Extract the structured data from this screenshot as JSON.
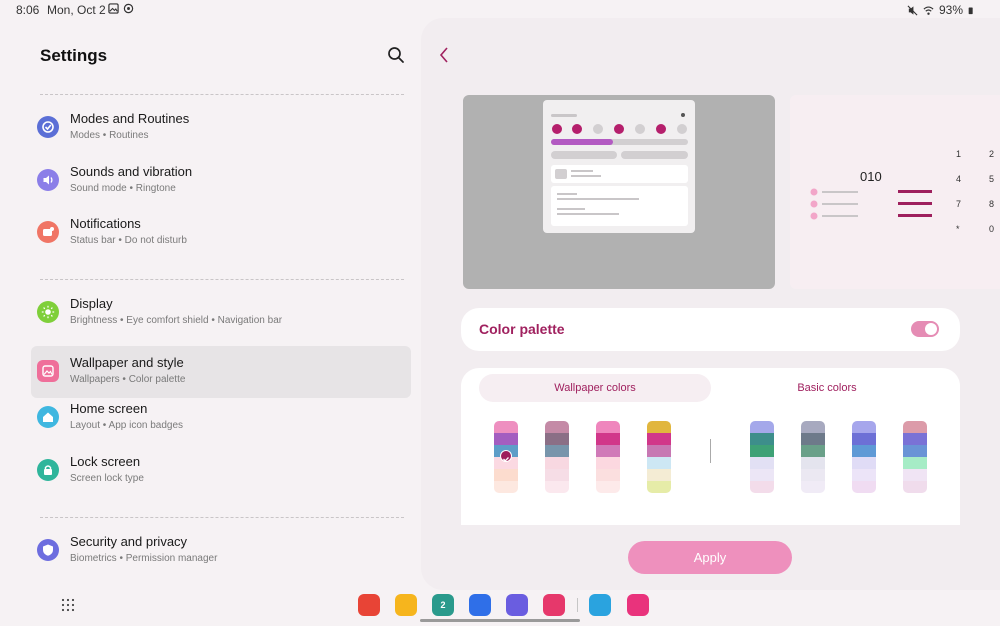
{
  "status_bar": {
    "time": "8:06",
    "date": "Mon, Oct 2",
    "battery": "93%"
  },
  "settings": {
    "title": "Settings",
    "items": [
      {
        "title": "Modes and Routines",
        "subtitle": "Modes  •  Routines",
        "color": "#5b6fd6"
      },
      {
        "title": "Sounds and vibration",
        "subtitle": "Sound mode  •  Ringtone",
        "color": "#8b7ee8"
      },
      {
        "title": "Notifications",
        "subtitle": "Status bar  •  Do not disturb",
        "color": "#f07565"
      },
      {
        "title": "Display",
        "subtitle": "Brightness  •  Eye comfort shield  •  Navigation bar",
        "color": "#7fcf3a"
      },
      {
        "title": "Wallpaper and style",
        "subtitle": "Wallpapers  •  Color palette",
        "color": "#ef6f9a"
      },
      {
        "title": "Home screen",
        "subtitle": "Layout  •  App icon badges",
        "color": "#3fb7e0"
      },
      {
        "title": "Lock screen",
        "subtitle": "Screen lock type",
        "color": "#2fb59b"
      },
      {
        "title": "Security and privacy",
        "subtitle": "Biometrics  •  Permission manager",
        "color": "#6d6ddf"
      }
    ]
  },
  "preview": {
    "number": "010",
    "dialpad": [
      "1",
      "2",
      "4",
      "5",
      "7",
      "8",
      "*",
      "0"
    ]
  },
  "color_palette": {
    "label": "Color palette",
    "enabled": true,
    "tabs": {
      "wallpaper": "Wallpaper colors",
      "basic": "Basic colors"
    },
    "wallpaper_swatches": [
      [
        "#ee8fc0",
        "#a35ec0",
        "#5d9ec8",
        "#fbd9e2",
        "#fcdcce",
        "#fde8e0"
      ],
      [
        "#c48aa6",
        "#8b6f86",
        "#7895ab",
        "#f8d8e1",
        "#f6dde6",
        "#fbe8ee"
      ],
      [
        "#ef86bd",
        "#d1378a",
        "#d07ab8",
        "#fcd8e0",
        "#fbdfdf",
        "#fdeaea"
      ],
      [
        "#e1b63e",
        "#d1378a",
        "#c778b3",
        "#cde7f4",
        "#f4ecd4",
        "#e6eca8"
      ]
    ],
    "basic_swatches": [
      [
        "#a4a8ea",
        "#3d8e8b",
        "#3ea176",
        "#e2e0f4",
        "#ece6f6",
        "#f3dcea"
      ],
      [
        "#a7a9bf",
        "#6e7a8a",
        "#6aa089",
        "#e4e4ee",
        "#ebe8f2",
        "#f0ebf6"
      ],
      [
        "#a6a6ec",
        "#6d70d6",
        "#5f9ad6",
        "#e0dcf6",
        "#ece4f8",
        "#f0dcf2"
      ],
      [
        "#dc9ba9",
        "#7a72d6",
        "#6a94d6",
        "#a6ecc6",
        "#f0e4f4",
        "#f0dcec"
      ]
    ],
    "selected_index": 0
  },
  "apply_label": "Apply",
  "taskbar": {
    "apps": [
      {
        "name": "notes",
        "color": "#e84436",
        "label": ""
      },
      {
        "name": "files",
        "color": "#f6b51d",
        "label": ""
      },
      {
        "name": "calendar",
        "color": "#2a9a8c",
        "label": "2"
      },
      {
        "name": "messages",
        "color": "#2f6fe8",
        "label": ""
      },
      {
        "name": "internet",
        "color": "#6a5de0",
        "label": ""
      },
      {
        "name": "camera",
        "color": "#e6386b",
        "label": ""
      },
      {
        "name": "telegram",
        "color": "#2aa3df",
        "label": ""
      },
      {
        "name": "flower",
        "color": "#e9337c",
        "label": ""
      }
    ]
  }
}
